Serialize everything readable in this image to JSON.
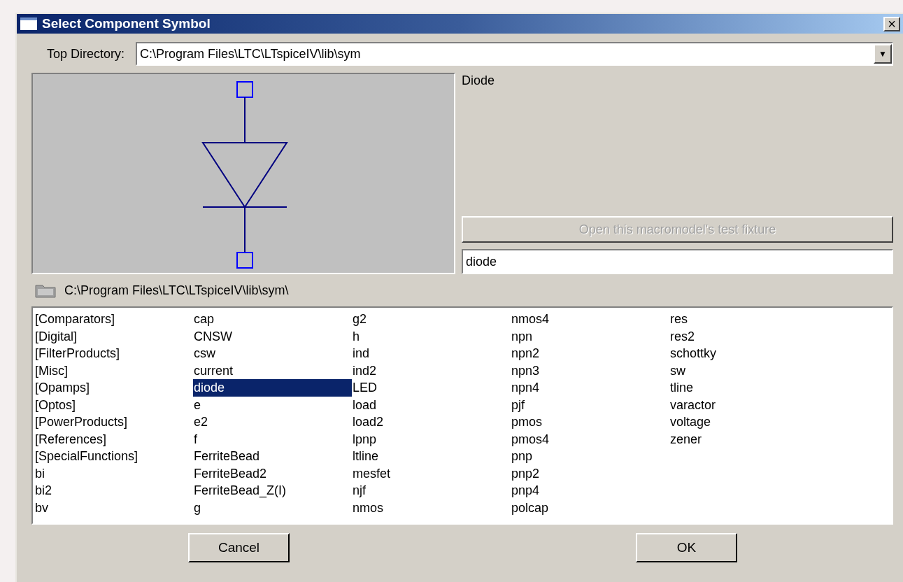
{
  "window": {
    "title": "Select Component Symbol",
    "close": "×"
  },
  "top_directory": {
    "label": "Top Directory:",
    "value": "C:\\Program Files\\LTC\\LTspiceIV\\lib\\sym",
    "dropdown": "▼"
  },
  "preview": {
    "name": "Diode"
  },
  "fixture_button": {
    "label": "Open this macromodel's test fixture",
    "disabled": true
  },
  "symbol_field": {
    "value": "diode"
  },
  "current_path": "C:\\Program Files\\LTC\\LTspiceIV\\lib\\sym\\",
  "symbols": [
    {
      "label": "[Comparators]",
      "selected": false
    },
    {
      "label": "[Digital]",
      "selected": false
    },
    {
      "label": "[FilterProducts]",
      "selected": false
    },
    {
      "label": "[Misc]",
      "selected": false
    },
    {
      "label": "[Opamps]",
      "selected": false
    },
    {
      "label": "[Optos]",
      "selected": false
    },
    {
      "label": "[PowerProducts]",
      "selected": false
    },
    {
      "label": "[References]",
      "selected": false
    },
    {
      "label": "[SpecialFunctions]",
      "selected": false
    },
    {
      "label": "bi",
      "selected": false
    },
    {
      "label": "bi2",
      "selected": false
    },
    {
      "label": "bv",
      "selected": false
    },
    {
      "label": "cap",
      "selected": false
    },
    {
      "label": "CNSW",
      "selected": false
    },
    {
      "label": "csw",
      "selected": false
    },
    {
      "label": "current",
      "selected": false
    },
    {
      "label": "diode",
      "selected": true
    },
    {
      "label": "e",
      "selected": false
    },
    {
      "label": "e2",
      "selected": false
    },
    {
      "label": "f",
      "selected": false
    },
    {
      "label": "FerriteBead",
      "selected": false
    },
    {
      "label": "FerriteBead2",
      "selected": false
    },
    {
      "label": "FerriteBead_Z(I)",
      "selected": false
    },
    {
      "label": "g",
      "selected": false
    },
    {
      "label": "g2",
      "selected": false
    },
    {
      "label": "h",
      "selected": false
    },
    {
      "label": "ind",
      "selected": false
    },
    {
      "label": "ind2",
      "selected": false
    },
    {
      "label": "LED",
      "selected": false
    },
    {
      "label": "load",
      "selected": false
    },
    {
      "label": "load2",
      "selected": false
    },
    {
      "label": "lpnp",
      "selected": false
    },
    {
      "label": "ltline",
      "selected": false
    },
    {
      "label": "mesfet",
      "selected": false
    },
    {
      "label": "njf",
      "selected": false
    },
    {
      "label": "nmos",
      "selected": false
    },
    {
      "label": "nmos4",
      "selected": false
    },
    {
      "label": "npn",
      "selected": false
    },
    {
      "label": "npn2",
      "selected": false
    },
    {
      "label": "npn3",
      "selected": false
    },
    {
      "label": "npn4",
      "selected": false
    },
    {
      "label": "pjf",
      "selected": false
    },
    {
      "label": "pmos",
      "selected": false
    },
    {
      "label": "pmos4",
      "selected": false
    },
    {
      "label": "pnp",
      "selected": false
    },
    {
      "label": "pnp2",
      "selected": false
    },
    {
      "label": "pnp4",
      "selected": false
    },
    {
      "label": "polcap",
      "selected": false
    },
    {
      "label": "res",
      "selected": false
    },
    {
      "label": "res2",
      "selected": false
    },
    {
      "label": "schottky",
      "selected": false
    },
    {
      "label": "sw",
      "selected": false
    },
    {
      "label": "tline",
      "selected": false
    },
    {
      "label": "varactor",
      "selected": false
    },
    {
      "label": "voltage",
      "selected": false
    },
    {
      "label": "zener",
      "selected": false
    }
  ],
  "cancel_button": {
    "label": "Cancel"
  },
  "ok_button": {
    "label": "OK"
  }
}
